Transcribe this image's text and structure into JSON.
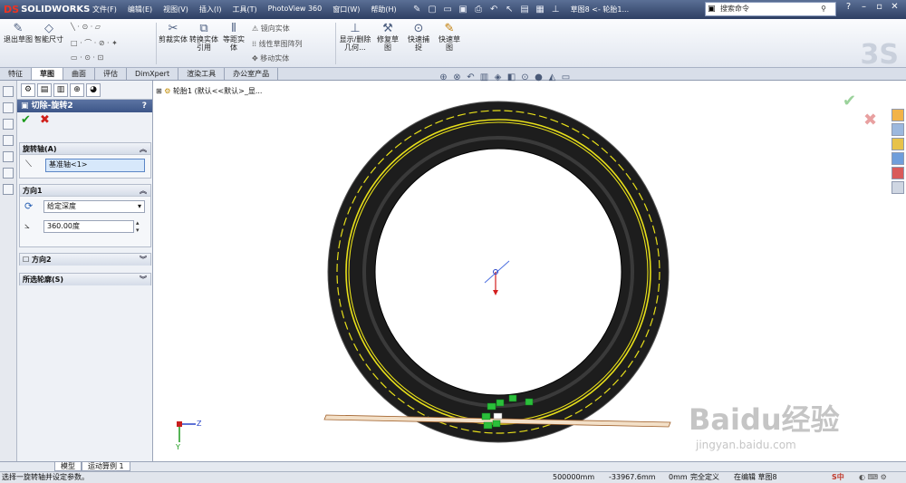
{
  "app": {
    "logo": "SOLIDWORKS",
    "logo_prefix": "DS",
    "doc_title": "草图8 <- 轮胎1..."
  },
  "menu": [
    "文件(F)",
    "编辑(E)",
    "视图(V)",
    "插入(I)",
    "工具(T)",
    "PhotoView 360",
    "窗口(W)",
    "帮助(H)"
  ],
  "search": {
    "placeholder": "搜索命令"
  },
  "command_manager": {
    "exit_sketch": "退出草图",
    "smart_dim": "智能尺寸",
    "trim": "剪裁实体",
    "convert": "转换实体引用",
    "offset": "等距实体",
    "mirror": "镜向实体",
    "linear_pattern": "线性草图阵列",
    "move": "移动实体",
    "show_hide": "显示/删除几何...",
    "repair": "修复草图",
    "quick_snap": "快速捕捉",
    "rapid_sketch": "快速草图"
  },
  "tabs": [
    "特征",
    "草图",
    "曲面",
    "评估",
    "DimXpert",
    "渲染工具",
    "办公室产品"
  ],
  "property_manager": {
    "title": "切除-旋转2",
    "help": "?",
    "axis_group": "旋转轴(A)",
    "axis_value": "基准轴<1>",
    "dir1_group": "方向1",
    "end_condition": "给定深度",
    "angle": "360.00度",
    "dir2_group": "方向2",
    "contours_group": "所选轮廓(S)"
  },
  "tree": {
    "crumb": "轮胎1  (默认<<默认>_显..."
  },
  "triad": {
    "y": "Y",
    "z": "Z"
  },
  "bottom_tabs": [
    "模型",
    "运动算例 1"
  ],
  "status": {
    "message": "选择一旋转轴并设定参数。",
    "x": "500000mm",
    "y": "-33967.6mm",
    "z": "0mm",
    "state": "完全定义",
    "editing": "在编辑 草图8"
  },
  "watermark": {
    "brand": "Baidu经验",
    "url": "jingyan.baidu.com"
  },
  "colors": {
    "accent": "#3d5688",
    "tire": "#1b1b1b",
    "stripe": "#e8e01a",
    "ok": "#1a9a1a",
    "cancel": "#d0201a"
  }
}
